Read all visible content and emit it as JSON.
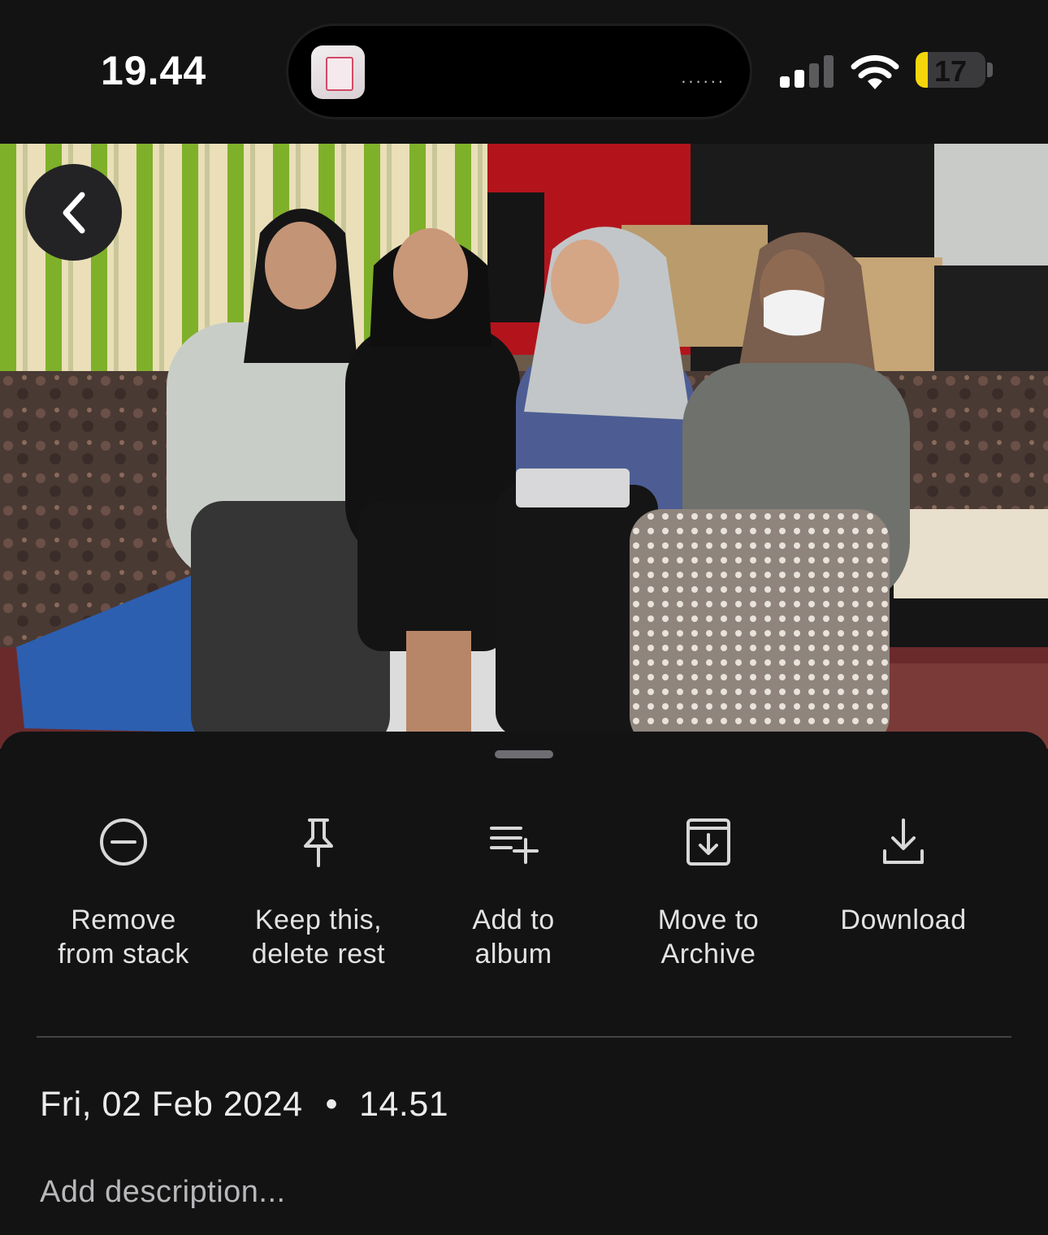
{
  "status_bar": {
    "time": "19.44",
    "island_dots": "......",
    "signal_bars_active": 2,
    "signal_bars_total": 4,
    "battery_level": 17,
    "battery_color": "#f5d60a"
  },
  "photo": {
    "back_icon": "chevron-left-icon"
  },
  "actions": [
    {
      "icon": "remove-circle-icon",
      "label": "Remove\nfrom stack"
    },
    {
      "icon": "pin-icon",
      "label": "Keep this,\ndelete rest"
    },
    {
      "icon": "playlist-add-icon",
      "label": "Add to\nalbum"
    },
    {
      "icon": "archive-icon",
      "label": "Move to\nArchive"
    },
    {
      "icon": "download-icon",
      "label": "Download"
    }
  ],
  "info": {
    "date": "Fri, 02 Feb 2024",
    "separator": "•",
    "time": "14.51",
    "description_placeholder": "Add description..."
  }
}
